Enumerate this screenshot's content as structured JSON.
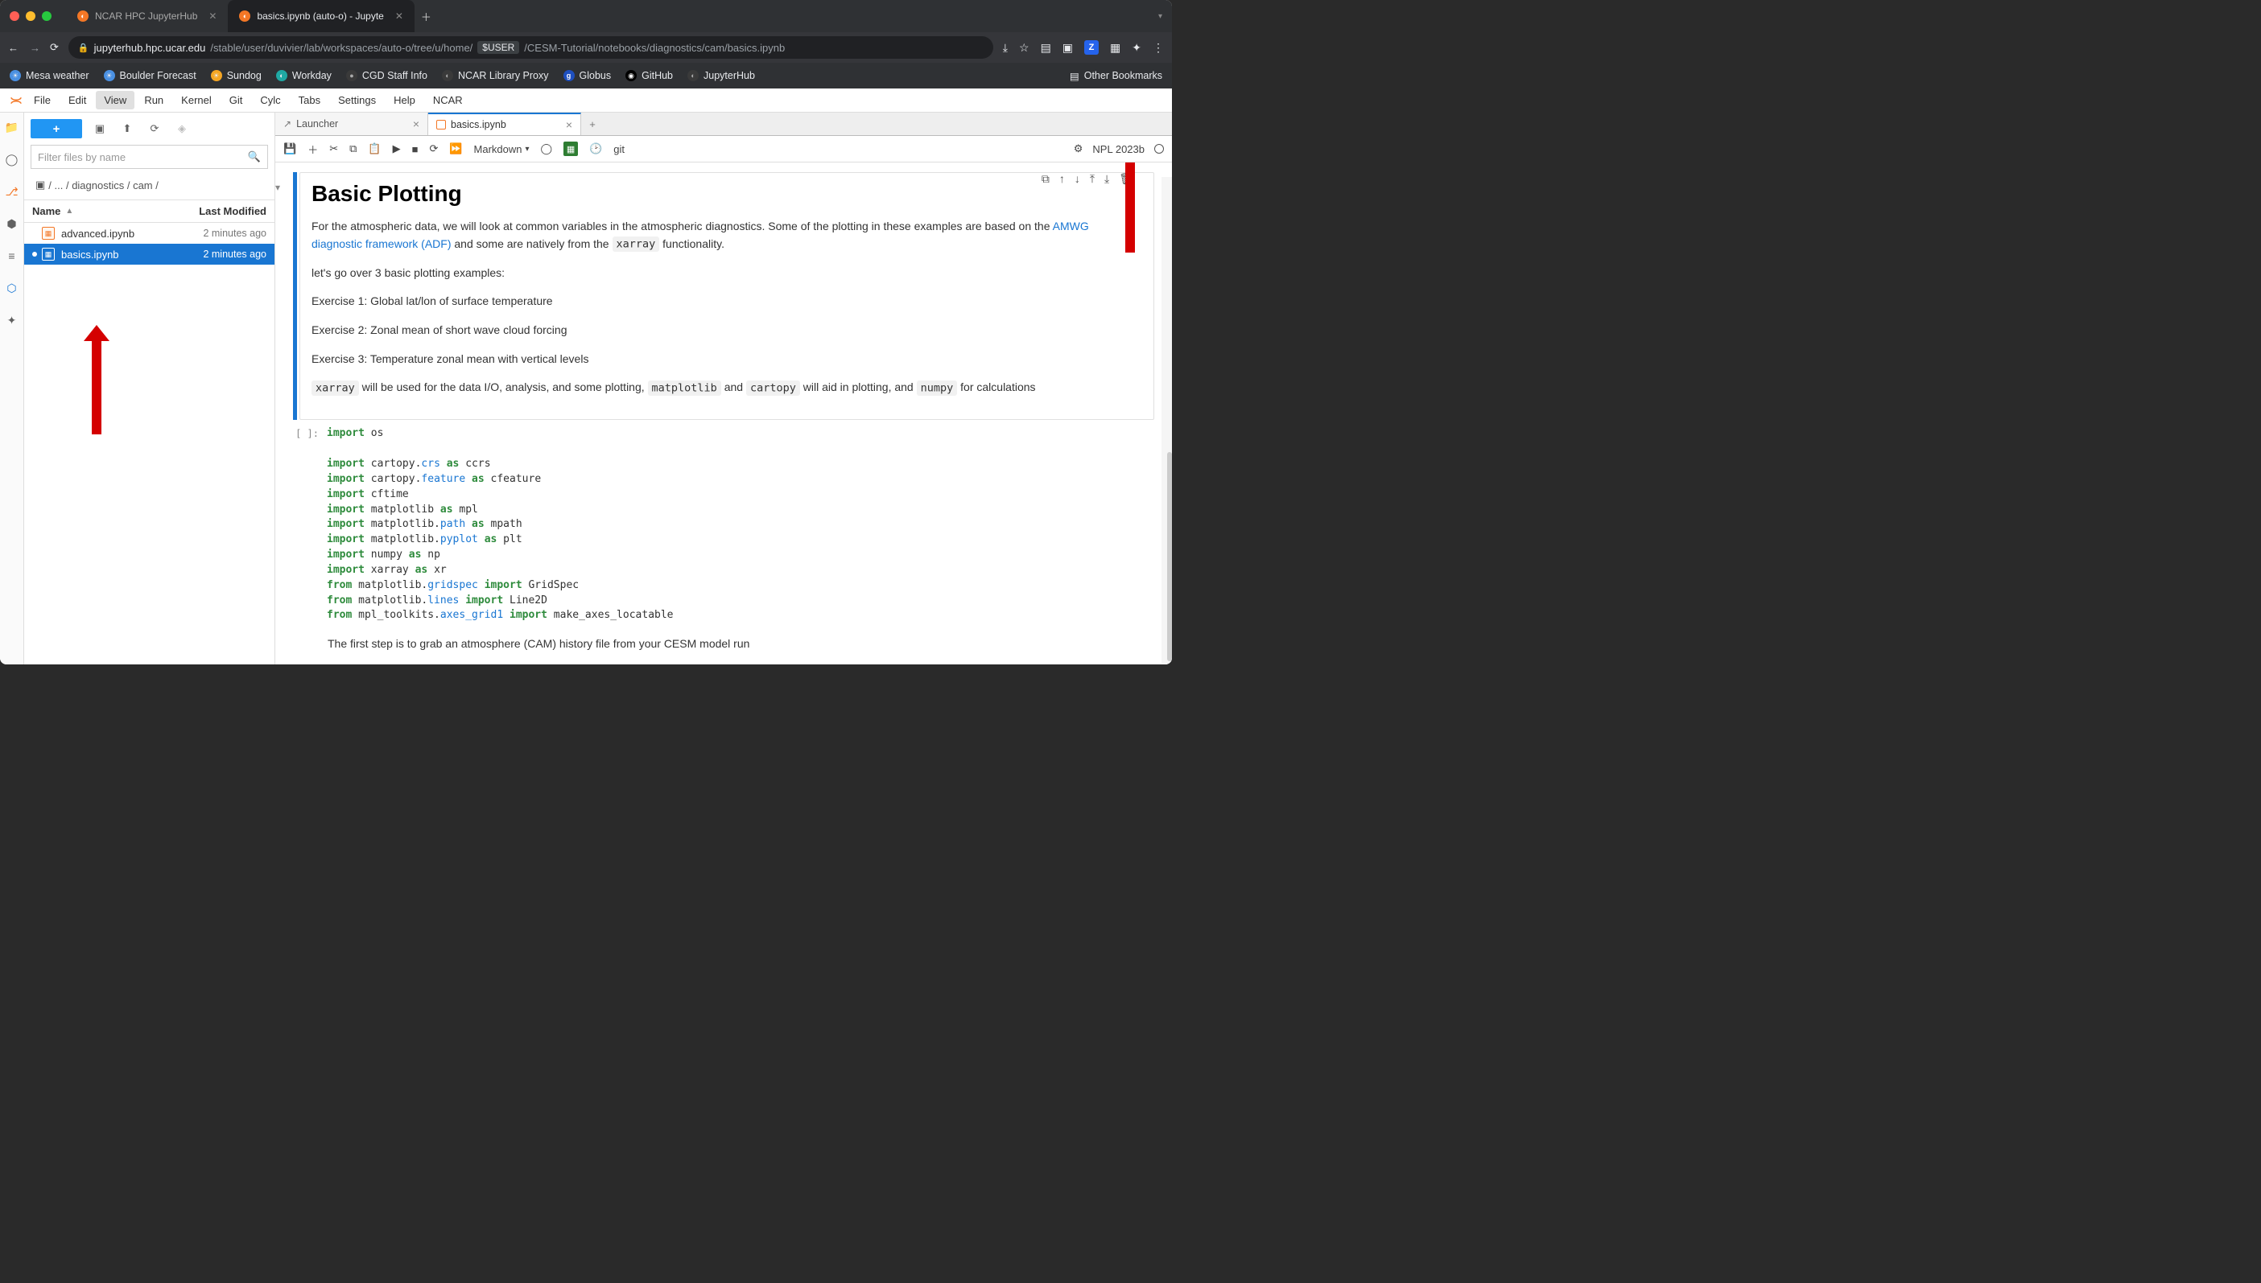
{
  "browser": {
    "tabs": [
      {
        "title": "NCAR HPC JupyterHub"
      },
      {
        "title": "basics.ipynb (auto-o) - Jupyte"
      }
    ],
    "url_host": "jupyterhub.hpc.ucar.edu",
    "url_path1": "/stable/user/duvivier/lab/workspaces/auto-o/tree/u/home/",
    "url_user": "$USER",
    "url_path2": "/CESM-Tutorial/notebooks/diagnostics/cam/basics.ipynb",
    "bookmarks": [
      "Mesa weather",
      "Boulder Forecast",
      "Sundog",
      "Workday",
      "CGD Staff Info",
      "NCAR Library Proxy",
      "Globus",
      "GitHub",
      "JupyterHub"
    ],
    "other_bookmarks": "Other Bookmarks"
  },
  "menu": [
    "File",
    "Edit",
    "View",
    "Run",
    "Kernel",
    "Git",
    "Cylc",
    "Tabs",
    "Settings",
    "Help",
    "NCAR"
  ],
  "filebrowser": {
    "filter_placeholder": "Filter files by name",
    "crumbs": "/ ... / diagnostics / cam /",
    "header_name": "Name",
    "header_modified": "Last Modified",
    "files": [
      {
        "name": "advanced.ipynb",
        "modified": "2 minutes ago",
        "selected": false
      },
      {
        "name": "basics.ipynb",
        "modified": "2 minutes ago",
        "selected": true
      }
    ]
  },
  "notebook": {
    "tabs": [
      {
        "label": "Launcher",
        "active": false,
        "kind": "launcher"
      },
      {
        "label": "basics.ipynb",
        "active": true,
        "kind": "nb"
      }
    ],
    "celltype": "Markdown",
    "git_label": "git",
    "kernel": "NPL 2023b",
    "title": "Basic Plotting",
    "p1a": "For the atmospheric data, we will look at common variables in the atmospheric diagnostics. Some of the plotting in these examples are based on the ",
    "p1link": "AMWG diagnostic framework (ADF)",
    "p1b": " and some are natively from the ",
    "p1c": " functionality.",
    "xarray": "xarray",
    "matplotlib": "matplotlib",
    "cartopy": "cartopy",
    "numpy": "numpy",
    "p2": "let's go over 3 basic plotting examples:",
    "ex1": "Exercise 1: Global lat/lon of surface temperature",
    "ex2": "Exercise 2: Zonal mean of short wave cloud forcing",
    "ex3": "Exercise 3: Temperature zonal mean with vertical levels",
    "p3a": " will be used for the data I/O, analysis, and some plotting, ",
    "p3b": " and ",
    "p3c": " will aid in plotting, and ",
    "p3d": " for calculations",
    "prompt": "[ ]:",
    "p4": "The first step is to grab an atmosphere (CAM) history file from your CESM model run"
  }
}
